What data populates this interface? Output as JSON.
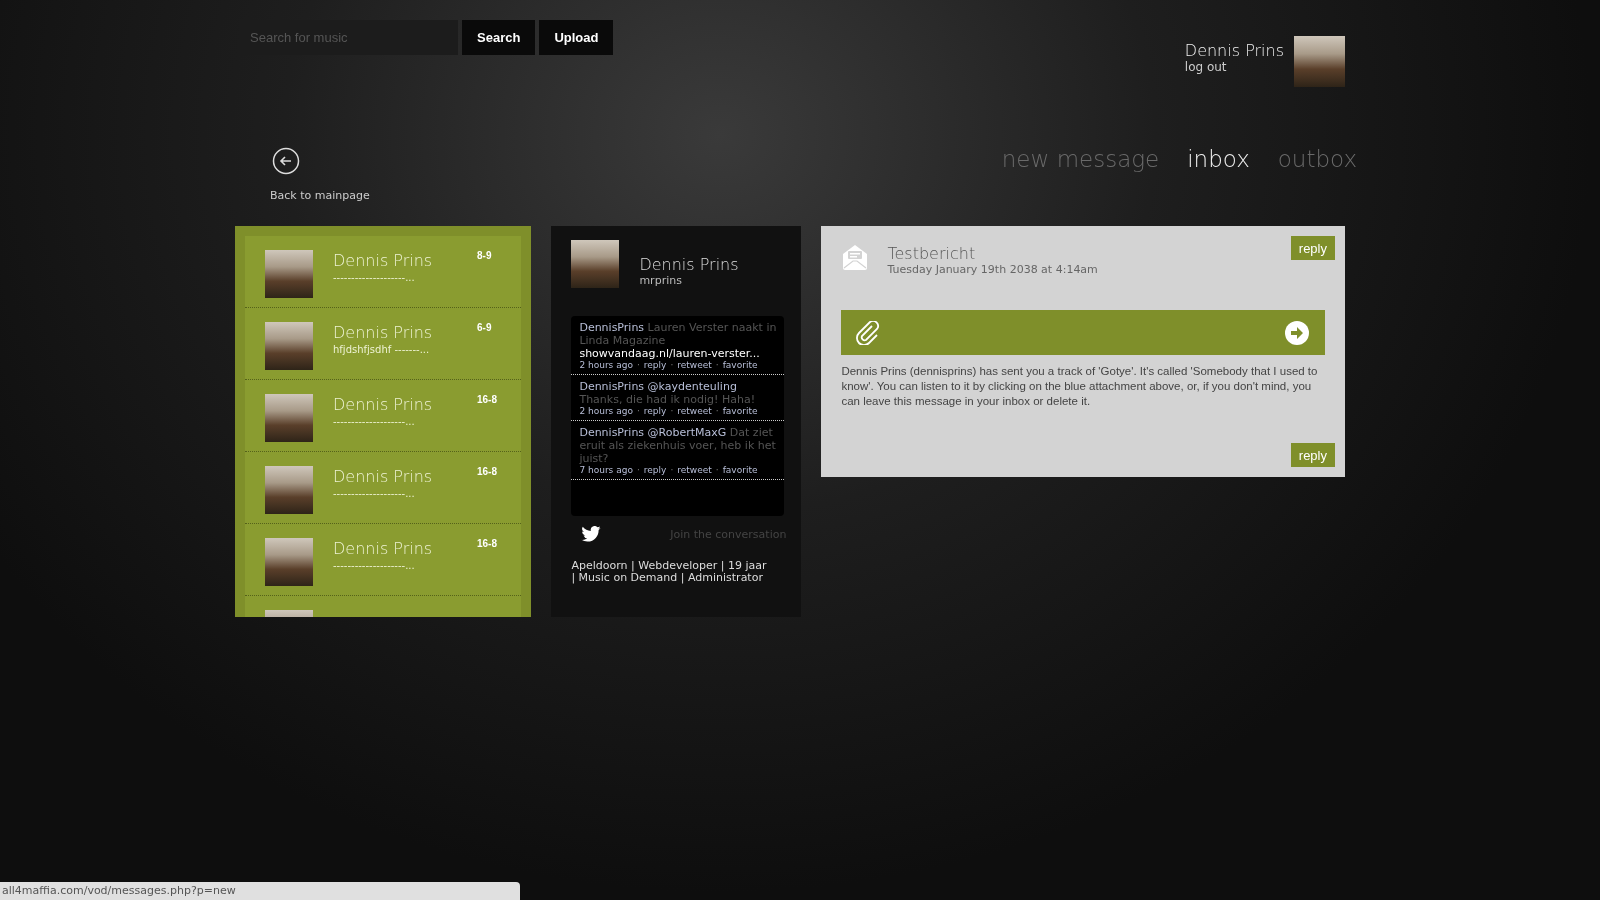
{
  "search": {
    "placeholder": "Search for music"
  },
  "buttons": [
    {
      "label": "Search"
    },
    {
      "label": "Upload"
    }
  ],
  "user": {
    "name": "Dennis Prins",
    "logout": "log out"
  },
  "back": {
    "label": "Back to mainpage"
  },
  "tabs": [
    {
      "label": "new message",
      "selected": false
    },
    {
      "label": "inbox",
      "selected": true
    },
    {
      "label": "outbox",
      "selected": false
    }
  ],
  "messages": [
    {
      "sender": "Dennis Prins",
      "preview": "--------------------...",
      "date": "8-9"
    },
    {
      "sender": "Dennis Prins",
      "preview": "hfjdshfjsdhf -------...",
      "date": "6-9"
    },
    {
      "sender": "Dennis Prins",
      "preview": "--------------------...",
      "date": "16-8"
    },
    {
      "sender": "Dennis Prins",
      "preview": "--------------------...",
      "date": "16-8"
    },
    {
      "sender": "Dennis Prins",
      "preview": "--------------------...",
      "date": "16-8"
    }
  ],
  "profile": {
    "name": "Dennis Prins",
    "handle": "mrprins",
    "separator": "·",
    "tweets": [
      {
        "user": "DennisPrins",
        "text": "Lauren Verster naakt in Linda Magazine",
        "link": "showvandaag.nl/lauren-verster...",
        "meta": [
          "2 hours ago",
          "reply",
          "retweet",
          "favorite"
        ]
      },
      {
        "user": "DennisPrins",
        "mention": "@kaydenteuling",
        "text": "Thanks, die had ik nodig! Haha!",
        "meta": [
          "2 hours ago",
          "reply",
          "retweet",
          "favorite"
        ]
      },
      {
        "user": "DennisPrins",
        "mention": "@RobertMaxG",
        "text": "Dat ziet eruit als ziekenhuis voer, heb ik het juist?",
        "meta": [
          "7 hours ago",
          "reply",
          "retweet",
          "favorite"
        ]
      }
    ],
    "join": "Join the conversation",
    "bio": "Apeldoorn | Webdeveloper | 19 jaar | Music on Demand | Administrator"
  },
  "message": {
    "title": "Testbericht",
    "date": "Tuesday January 19th 2038 at 4:14am",
    "reply_top": "reply",
    "body": "Dennis Prins (dennisprins) has sent you a track of 'Gotye'. It's called 'Somebody that I used to know'. You can listen to it by clicking on the blue attachment above, or, if you don't mind, you can leave this message in your inbox or delete it.",
    "reply_bottom": "reply"
  },
  "status_bar": "all4maffia.com/vod/messages.php?p=new"
}
